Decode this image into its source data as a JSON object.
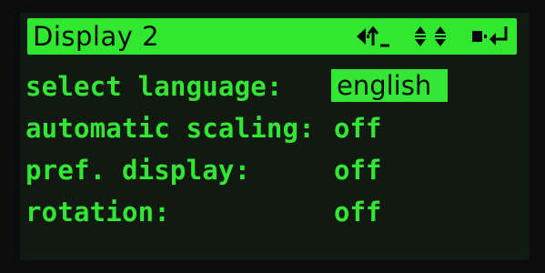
{
  "header": {
    "title": "Display 2",
    "icons": [
      "back-arrow-icon",
      "up-down-arrows-icon",
      "enter-icon"
    ]
  },
  "menu": {
    "items": [
      {
        "label": "select language:",
        "value": "english",
        "selected": true
      },
      {
        "label": "automatic scaling:",
        "value": "off"
      },
      {
        "label": "pref. display:",
        "value": "off"
      },
      {
        "label": "rotation:",
        "value": "off"
      }
    ]
  },
  "colors": {
    "accent": "#35e535",
    "background": "#101a10",
    "title_text": "#050805"
  }
}
